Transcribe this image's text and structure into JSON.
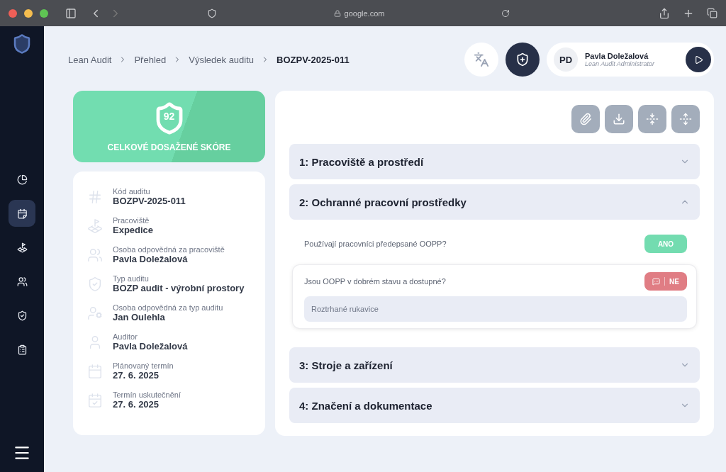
{
  "browser": {
    "url": "google.com"
  },
  "sidebar": {
    "items": [
      {
        "selected": false
      },
      {
        "selected": true
      },
      {
        "selected": false
      },
      {
        "selected": false
      },
      {
        "selected": false
      },
      {
        "selected": false
      }
    ]
  },
  "breadcrumb": [
    {
      "label": "Lean Audit",
      "current": false
    },
    {
      "label": "Přehled",
      "current": false
    },
    {
      "label": "Výsledek auditu",
      "current": false
    },
    {
      "label": "BOZPV-2025-011",
      "current": true
    }
  ],
  "user": {
    "initials": "PD",
    "name": "Pavla Doležalová",
    "role": "Lean Audit Administrator"
  },
  "score": {
    "value": "92",
    "label": "CELKOVÉ DOSAŽENÉ SKÓRE"
  },
  "details": [
    {
      "label": "Kód auditu",
      "value": "BOZPV-2025-011"
    },
    {
      "label": "Pracoviště",
      "value": "Expedice"
    },
    {
      "label": "Osoba odpovědná za pracoviště",
      "value": "Pavla Doležalová"
    },
    {
      "label": "Typ auditu",
      "value": "BOZP audit - výrobní prostory"
    },
    {
      "label": "Osoba odpovědná za typ auditu",
      "value": "Jan Oulehla"
    },
    {
      "label": "Auditor",
      "value": "Pavla Doležalová"
    },
    {
      "label": "Plánovaný termín",
      "value": "27. 6. 2025"
    },
    {
      "label": "Termín uskutečnění",
      "value": "27. 6. 2025"
    }
  ],
  "sections": [
    {
      "title": "1: Pracoviště a prostředí",
      "expanded": false
    },
    {
      "title": "2: Ochranné pracovní prostředky",
      "expanded": true,
      "questions": [
        {
          "text": "Používají pracovníci předepsané OOPP?",
          "answer": "ANO",
          "positive": true,
          "has_comment": false,
          "focused": false
        },
        {
          "text": "Jsou OOPP v dobrém stavu a dostupné?",
          "answer": "NE",
          "positive": false,
          "has_comment": true,
          "focused": true,
          "note": "Roztrhané rukavice"
        }
      ]
    },
    {
      "title": "3: Stroje a zařízení",
      "expanded": false
    },
    {
      "title": "4: Značení a dokumentace",
      "expanded": false
    }
  ]
}
